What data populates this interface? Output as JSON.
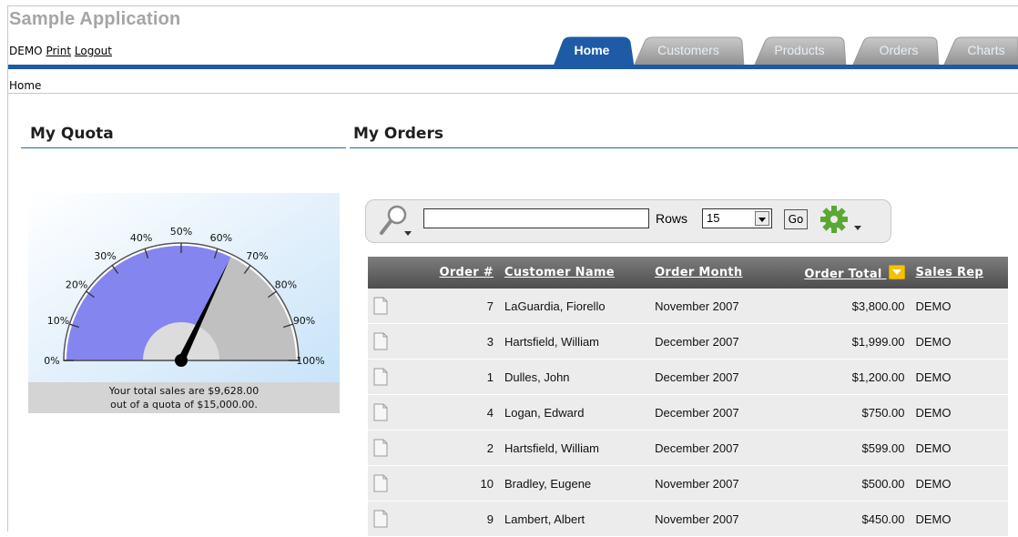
{
  "app": {
    "title": "Sample Application"
  },
  "user_nav": {
    "user": "DEMO",
    "print": "Print",
    "logout": "Logout"
  },
  "tabs": [
    {
      "label": "Home",
      "active": true
    },
    {
      "label": "Customers",
      "active": false
    },
    {
      "label": "Products",
      "active": false
    },
    {
      "label": "Orders",
      "active": false
    },
    {
      "label": "Charts",
      "active": false
    }
  ],
  "breadcrumb": "Home",
  "quota": {
    "title": "My Quota",
    "value_percent": 64.2,
    "ticks": [
      "0%",
      "10%",
      "20%",
      "30%",
      "40%",
      "50%",
      "60%",
      "70%",
      "80%",
      "90%",
      "100%"
    ],
    "caption_line1": "Your total sales are $9,628.00",
    "caption_line2": "out of a quota of $15,000.00.",
    "colors": {
      "fill": "#8585f0",
      "remaining": "#c0c0c0",
      "background": "#ddeefb"
    }
  },
  "orders": {
    "title": "My Orders",
    "search": {
      "value": "",
      "rows_label": "Rows",
      "rows_value": "15",
      "go_label": "Go"
    },
    "columns": [
      "Order #",
      "Customer Name",
      "Order Month",
      "Order Total",
      "Sales Rep"
    ],
    "rows": [
      {
        "order": "7",
        "customer": "LaGuardia, Fiorello",
        "month": "November 2007",
        "total": "$3,800.00",
        "rep": "DEMO"
      },
      {
        "order": "3",
        "customer": "Hartsfield, William",
        "month": "December 2007",
        "total": "$1,999.00",
        "rep": "DEMO"
      },
      {
        "order": "1",
        "customer": "Dulles, John",
        "month": "December 2007",
        "total": "$1,200.00",
        "rep": "DEMO"
      },
      {
        "order": "4",
        "customer": "Logan, Edward",
        "month": "December 2007",
        "total": "$750.00",
        "rep": "DEMO"
      },
      {
        "order": "2",
        "customer": "Hartsfield, William",
        "month": "December 2007",
        "total": "$599.00",
        "rep": "DEMO"
      },
      {
        "order": "10",
        "customer": "Bradley, Eugene",
        "month": "November 2007",
        "total": "$500.00",
        "rep": "DEMO"
      },
      {
        "order": "9",
        "customer": "Lambert, Albert",
        "month": "November 2007",
        "total": "$450.00",
        "rep": "DEMO"
      }
    ]
  }
}
